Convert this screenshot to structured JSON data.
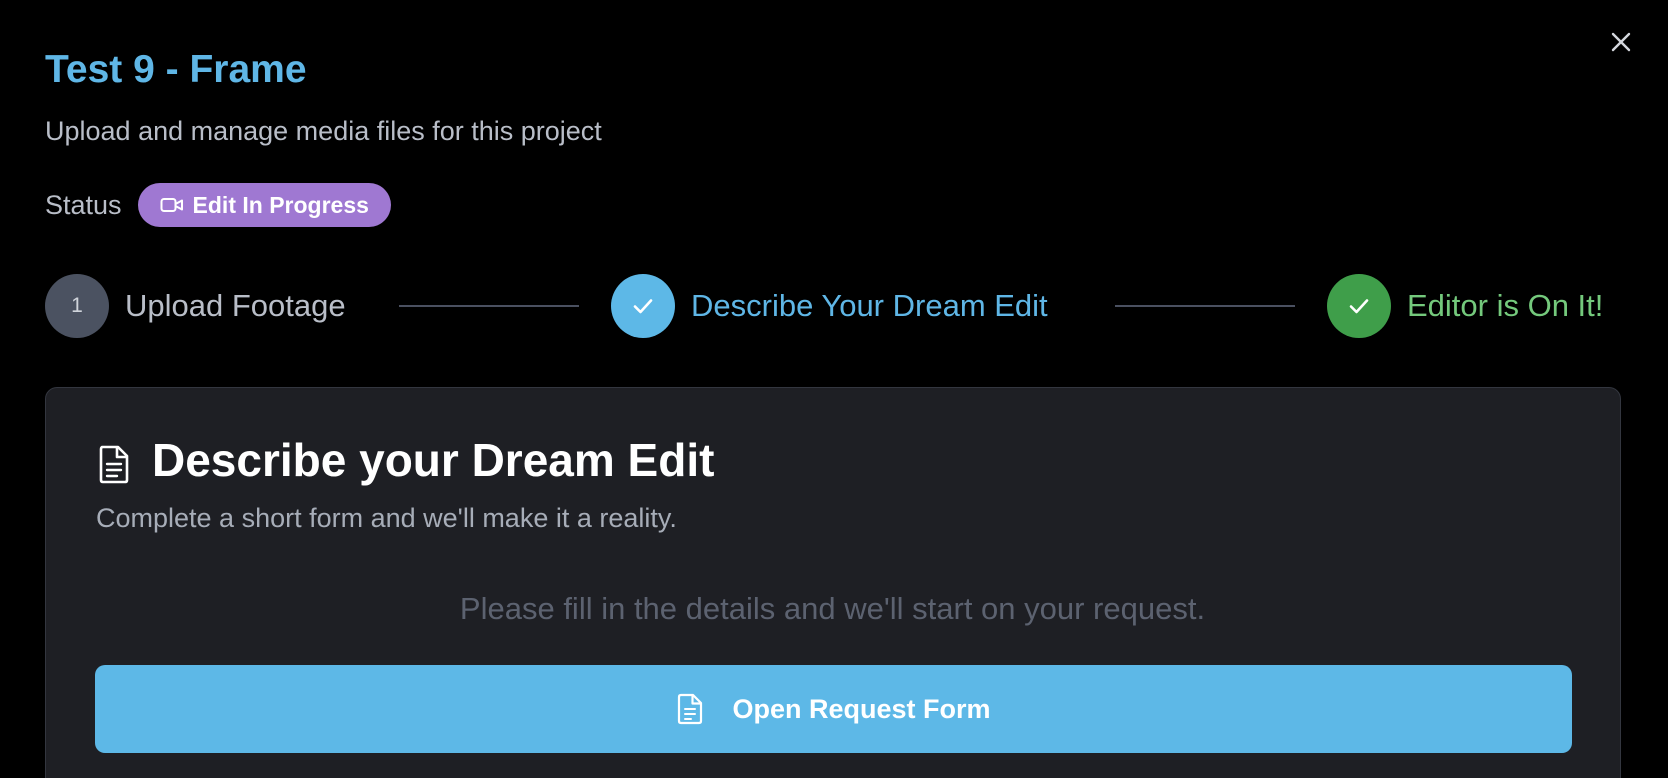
{
  "modal": {
    "title": "Test 9 - Frame",
    "subtitle": "Upload and manage media files for this project",
    "close_icon": "close-icon"
  },
  "status": {
    "label": "Status",
    "badge_text": "Edit In Progress",
    "badge_icon": "video-camera-icon",
    "badge_color": "#9f78d2"
  },
  "steps": [
    {
      "number": "1",
      "label": "Upload Footage",
      "state": "pending",
      "color": "#b9bec8",
      "circle_color": "#4b5261"
    },
    {
      "number": "",
      "label": "Describe Your Dream Edit",
      "state": "completed",
      "icon": "check-icon",
      "color": "#5fb6e6",
      "circle_color": "#5db8e7"
    },
    {
      "number": "",
      "label": "Editor is On It!",
      "state": "completed",
      "icon": "check-icon",
      "color": "#74c97c",
      "circle_color": "#3f9e4a"
    }
  ],
  "card": {
    "icon": "document-icon",
    "title": "Describe your Dream Edit",
    "subtitle": "Complete a short form and we'll make it a reality.",
    "hint": "Please fill in the details and we'll start on your request.",
    "button_label": "Open Request Form",
    "button_icon": "document-icon",
    "button_color": "#5db8e7"
  }
}
